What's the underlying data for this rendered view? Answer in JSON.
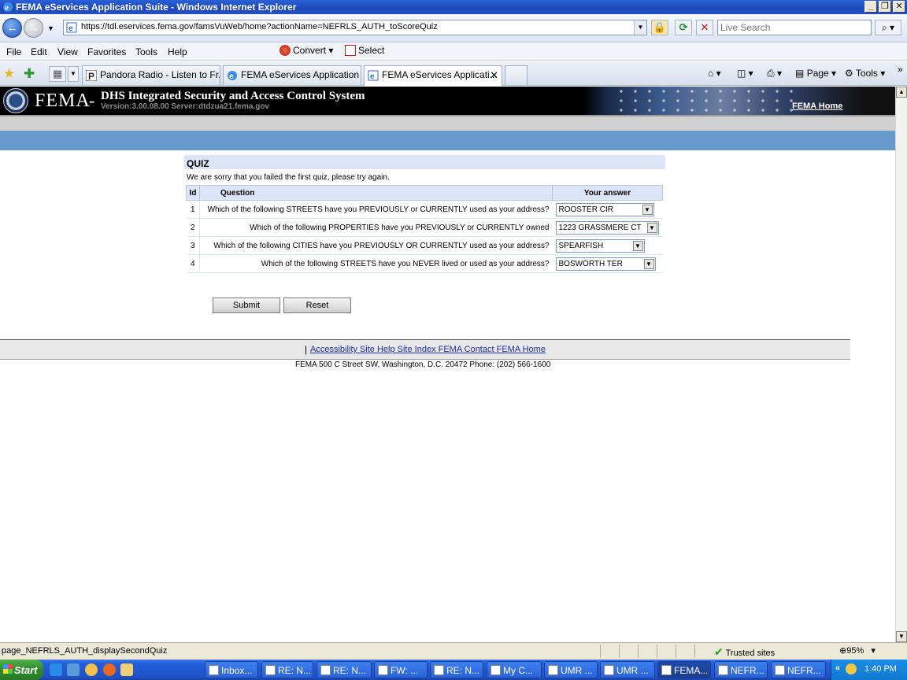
{
  "window": {
    "title": "FEMA eServices Application Suite - Windows Internet Explorer"
  },
  "navbar": {
    "url": "https://tdl.eservices.fema.gov/famsVuWeb/home?actionName=NEFRLS_AUTH_toScoreQuiz",
    "search_placeholder": "Live Search"
  },
  "menu": {
    "items": [
      "File",
      "Edit",
      "View",
      "Favorites",
      "Tools",
      "Help"
    ],
    "convert": "Convert",
    "select": "Select"
  },
  "tabs": [
    {
      "label": "Pandora Radio - Listen to Fr..."
    },
    {
      "label": "FEMA eServices Application ..."
    },
    {
      "label": "FEMA eServices Applicati..."
    }
  ],
  "commandbar": {
    "page": "Page",
    "tools": "Tools"
  },
  "banner": {
    "logo_text": "FEMA",
    "dash": "-",
    "system_name": "DHS Integrated Security and Access Control System",
    "version": "Version:3.00.08.00 Server:dtdzua21.fema.gov",
    "home_link": "FEMA Home"
  },
  "quiz": {
    "title": "QUIZ",
    "message": "We are sorry that you failed the first quiz, please try again.",
    "headers": {
      "id": "Id",
      "question": "Question",
      "answer": "Your answer"
    },
    "rows": [
      {
        "id": "1",
        "question": "Which of the following STREETS have you PREVIOUSLY or CURRENTLY used as your address?",
        "answer": "ROOSTER CIR"
      },
      {
        "id": "2",
        "question": "Which of the following PROPERTIES have you PREVIOUSLY or CURRENTLY owned",
        "answer": "1223 GRASSMERE CT"
      },
      {
        "id": "3",
        "question": "Which of the following CITIES have you PREVIOUSLY OR CURRENTLY used as your address?",
        "answer": "SPEARFISH"
      },
      {
        "id": "4",
        "question": "Which of the following STREETS have you NEVER lived or used as your address?",
        "answer": "BOSWORTH TER"
      }
    ],
    "submit": "Submit",
    "reset": "Reset"
  },
  "footer": {
    "separator": "|",
    "links": "Accessibility Site Help Site Index FEMA Contact FEMA Home",
    "address": "FEMA 500 C Street SW, Washington, D.C. 20472 Phone: (202) 566-1600"
  },
  "statusbar": {
    "text": "page_NEFRLS_AUTH_displaySecondQuiz",
    "zone": "Trusted sites",
    "zoom": "95%"
  },
  "taskbar": {
    "start": "Start",
    "buttons": [
      "Inbox...",
      "RE: N...",
      "RE: N...",
      "FW: ...",
      "RE: N...",
      "My C...",
      "UMR ...",
      "UMR ...",
      "FEMA...",
      "NEFR...",
      "NEFR..."
    ],
    "clock": "1:40 PM"
  }
}
